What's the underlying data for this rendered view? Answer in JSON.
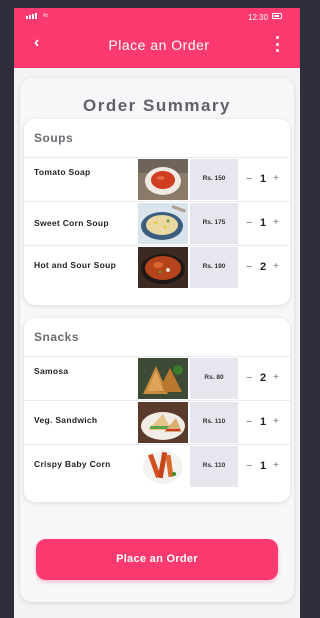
{
  "status_bar": {
    "time": "12:30"
  },
  "header": {
    "title": "Place an Order"
  },
  "summary_title": "Order Summary",
  "sections": [
    {
      "title": "Soups",
      "items": [
        {
          "name": "Tomato Soap",
          "price": "Rs. 150",
          "qty": "1",
          "image": "tomato-soup-image"
        },
        {
          "name": "Sweet Corn Soup",
          "price": "Rs. 175",
          "qty": "1",
          "image": "sweet-corn-soup-image"
        },
        {
          "name": "Hot and Sour Soup",
          "price": "Rs. 190",
          "qty": "2",
          "image": "hot-and-sour-soup-image"
        }
      ]
    },
    {
      "title": "Snacks",
      "items": [
        {
          "name": "Samosa",
          "price": "Rs. 80",
          "qty": "2",
          "image": "samosa-image"
        },
        {
          "name": "Veg. Sandwich",
          "price": "Rs. 110",
          "qty": "1",
          "image": "veg-sandwich-image"
        },
        {
          "name": "Crispy Baby Corn",
          "price": "Rs. 110",
          "qty": "1",
          "image": "crispy-baby-corn-image"
        }
      ]
    }
  ],
  "qty_controls": {
    "minus": "−",
    "plus": "+"
  },
  "cta_label": "Place an Order",
  "colors": {
    "accent": "#fd3a6f",
    "background": "#2f2e3b",
    "price_bg": "#e6e6ef"
  },
  "icons": {
    "back": "back-arrow-icon",
    "menu": "more-vertical-icon"
  }
}
